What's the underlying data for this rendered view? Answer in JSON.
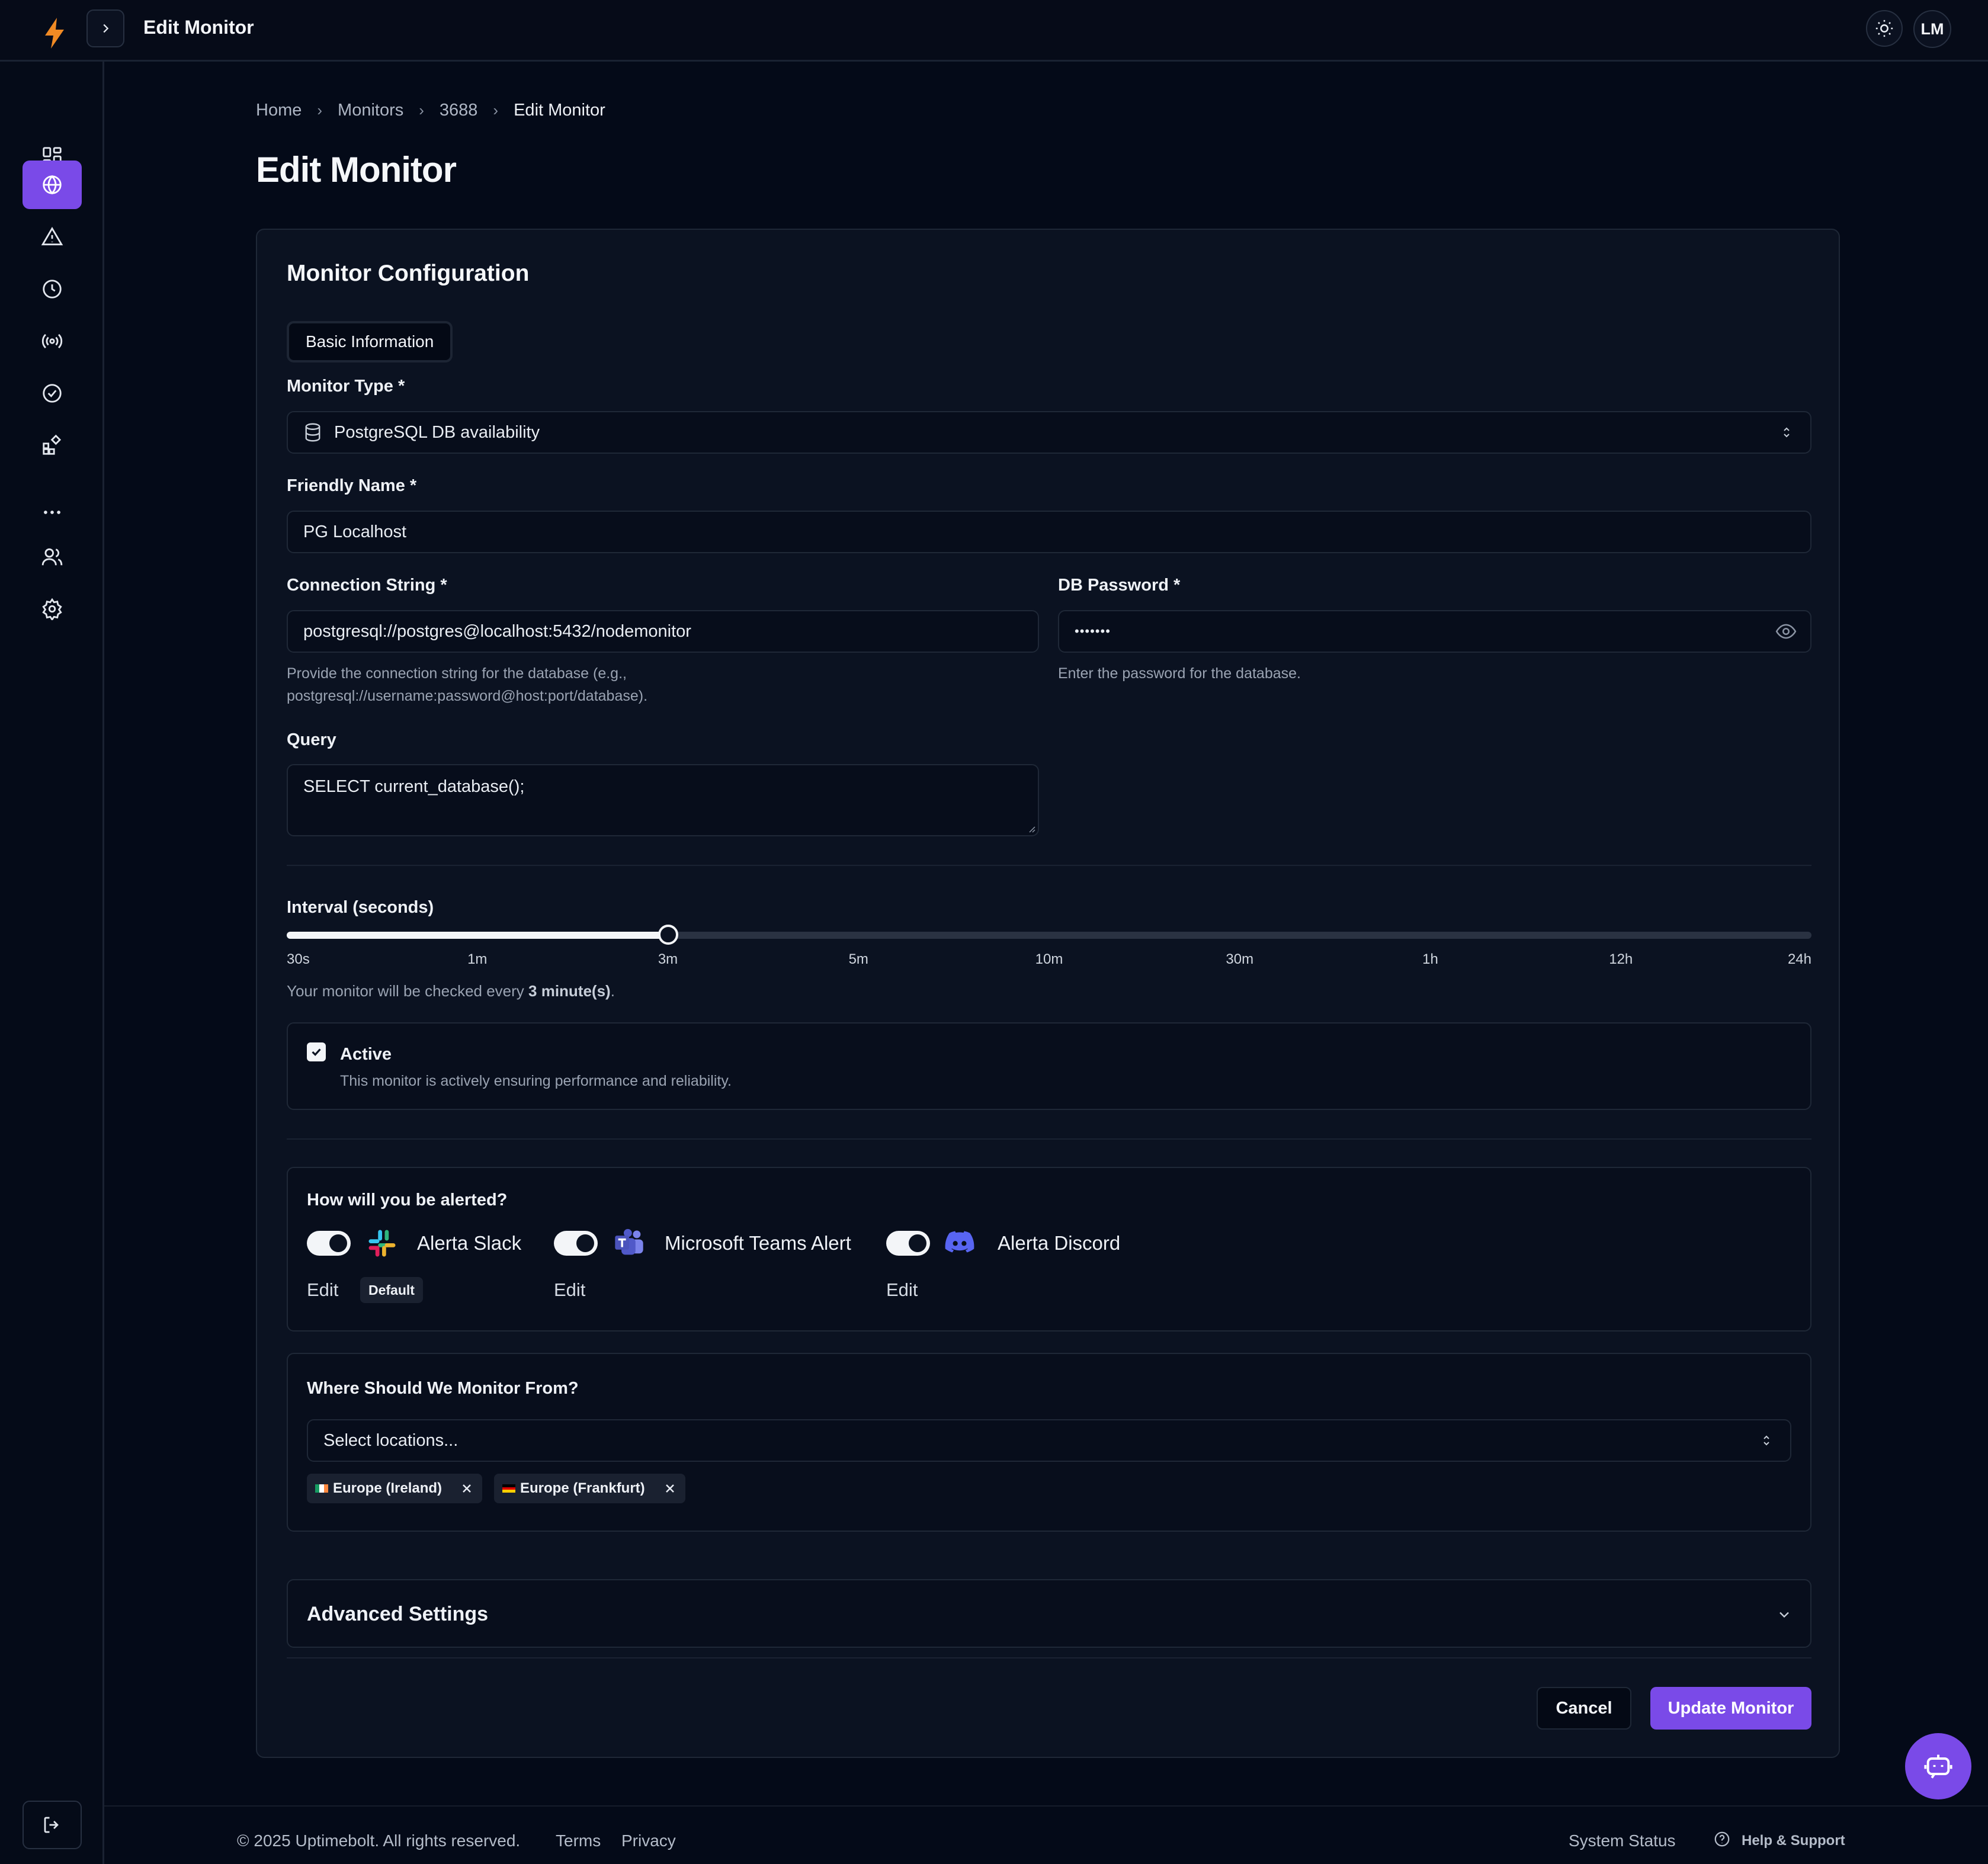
{
  "header": {
    "title": "Edit Monitor",
    "avatar_initials": "LM"
  },
  "breadcrumb": [
    {
      "label": "Home"
    },
    {
      "label": "Monitors"
    },
    {
      "label": "3688"
    },
    {
      "label": "Edit Monitor"
    }
  ],
  "page_title": "Edit Monitor",
  "card": {
    "title": "Monitor Configuration",
    "tab": "Basic Information",
    "monitor_type": {
      "label": "Monitor Type *",
      "value": "PostgreSQL DB availability"
    },
    "friendly_name": {
      "label": "Friendly Name *",
      "value": "PG Localhost"
    },
    "connection_string": {
      "label": "Connection String *",
      "value": "postgresql://postgres@localhost:5432/nodemonitor",
      "help_line1": "Provide the connection string for the database (e.g.,",
      "help_line2": "postgresql://username:password@host:port/database)."
    },
    "db_password": {
      "label": "DB Password *",
      "value": "•••••••",
      "help": "Enter the password for the database."
    },
    "query": {
      "label": "Query",
      "value": "SELECT current_database();"
    },
    "interval": {
      "label": "Interval (seconds)",
      "ticks": [
        "30s",
        "1m",
        "3m",
        "5m",
        "10m",
        "30m",
        "1h",
        "12h",
        "24h"
      ],
      "selected_index": 2,
      "summary_prefix": "Your monitor will be checked every ",
      "summary_value": "3 minute(s)",
      "summary_suffix": "."
    },
    "active": {
      "label": "Active",
      "description": "This monitor is actively ensuring performance and reliability.",
      "checked": true
    },
    "alerts": {
      "title": "How will you be alerted?",
      "channels": [
        {
          "name": "Alerta Slack",
          "edit": "Edit",
          "badge": "Default",
          "enabled": true
        },
        {
          "name": "Microsoft Teams Alert",
          "edit": "Edit",
          "enabled": true
        },
        {
          "name": "Alerta Discord",
          "edit": "Edit",
          "enabled": true
        }
      ]
    },
    "locations": {
      "title": "Where Should We Monitor From?",
      "placeholder": "Select locations...",
      "selected": [
        {
          "label": "Europe (Ireland)",
          "flag_colors": [
            "#169b62",
            "#ffffff",
            "#ff883e"
          ]
        },
        {
          "label": "Europe (Frankfurt)",
          "flag_colors": [
            "#000000",
            "#dd0000",
            "#ffce00"
          ]
        }
      ]
    },
    "advanced": {
      "title": "Advanced Settings"
    },
    "buttons": {
      "cancel": "Cancel",
      "update": "Update Monitor"
    }
  },
  "footer": {
    "copyright": "© 2025 Uptimebolt. All rights reserved.",
    "terms": "Terms",
    "privacy": "Privacy",
    "system_status": "System Status",
    "help": "Help & Support"
  },
  "colors": {
    "accent": "#7a4ae8",
    "background": "#040a18",
    "card": "#0b1221"
  }
}
